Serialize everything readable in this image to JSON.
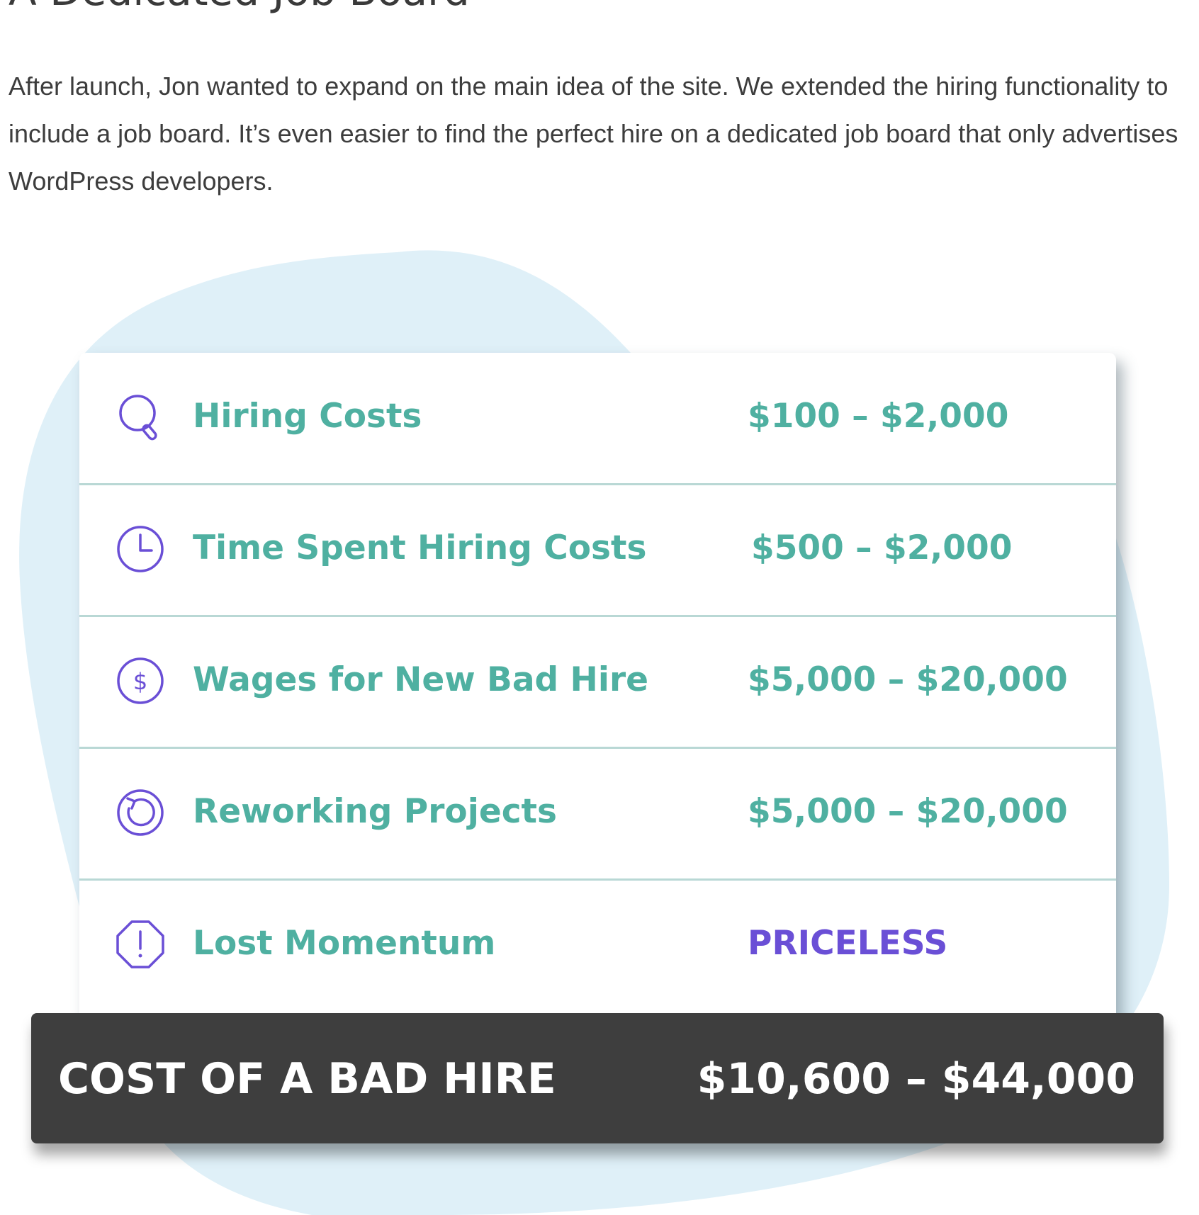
{
  "article": {
    "heading": "A Dedicated Job Board",
    "intro": "After launch, Jon wanted to expand on the main idea of the site. We extended the hiring functionality to include a job board. It’s even easier to find the perfect hire on a dedicated job board that only advertises WordPress developers."
  },
  "cost_table": {
    "rows": [
      {
        "icon": "search-icon",
        "label": "Hiring Costs",
        "value": "$100 – $2,000"
      },
      {
        "icon": "clock-icon",
        "label": "Time Spent Hiring Costs",
        "value": "$500 – $2,000"
      },
      {
        "icon": "dollar-circle-icon",
        "label": "Wages for New Bad Hire",
        "value": "$5,000 – $20,000"
      },
      {
        "icon": "refresh-icon",
        "label": "Reworking Projects",
        "value": "$5,000 – $20,000"
      },
      {
        "icon": "alert-octagon-icon",
        "label": "Lost Momentum",
        "value": "PRICELESS"
      }
    ],
    "total": {
      "label": "COST OF A BAD HIRE",
      "value": "$10,600 – $44,000"
    }
  },
  "colors": {
    "accent_teal": "#4fb0a1",
    "accent_purple": "#6a4fd6",
    "blob_blue": "#dff0f8",
    "total_bar": "#3e3e3e",
    "divider": "#b9d8d5"
  }
}
